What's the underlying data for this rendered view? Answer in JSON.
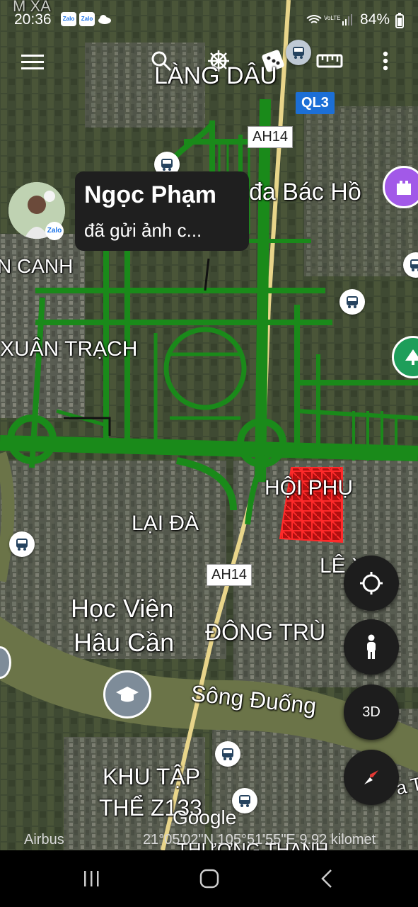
{
  "status": {
    "time": "20:36",
    "apps": [
      "Zalo",
      "Zalo"
    ],
    "battery": "84%"
  },
  "toolbar": {
    "menu_icon": "hamburger-menu-icon",
    "search_icon": "search-icon",
    "voyager_icon": "ship-wheel-icon",
    "random_icon": "dice-icon",
    "measure_icon": "ruler-icon",
    "more_icon": "more-vert-icon"
  },
  "notification": {
    "sender": "Ngọc Phạm",
    "message": "đã gửi ảnh c...",
    "badge": "Zalo"
  },
  "places": {
    "lang_dau": "LÀNG DÂU",
    "bac_ho": "đa Bác Hồ",
    "canh": "N CANH",
    "xuan_trach": "XUÂN TRẠCH",
    "hoi_phu": "HỘI PHỤ",
    "lai_da": "LẠI ĐÀ",
    "le_x": "LÊ X",
    "hoc_vien_1": "Học Viện",
    "hoc_vien_2": "Hậu Cần",
    "dong_tru": "ĐÔNG TRÙ",
    "song_duong": "Sông Đuống",
    "khu_tap_1": "KHU TẬP",
    "khu_tap_2": "THỂ Z133",
    "thuong_thanh": "THƯỢNG THANH",
    "m_xa": "M XÃ",
    "a_t": "a T"
  },
  "shields": {
    "ql3": "QL3",
    "ah14_top": "AH14",
    "ah14_bottom": "AH14"
  },
  "fabs": {
    "location_icon": "my-location-icon",
    "pegman_icon": "pegman-icon",
    "three_d": "3D",
    "compass_icon": "compass-icon"
  },
  "footer": {
    "attribution": "Airbus",
    "google": "Google",
    "coords": "21°05'02\"N 105°51'55\"E 9.92 kilomet"
  },
  "colors": {
    "overlay_green": "#1a8a1a",
    "parcel_red": "#ff1a1a",
    "road_yellow": "#e8d58a",
    "river": "#6b7448"
  }
}
